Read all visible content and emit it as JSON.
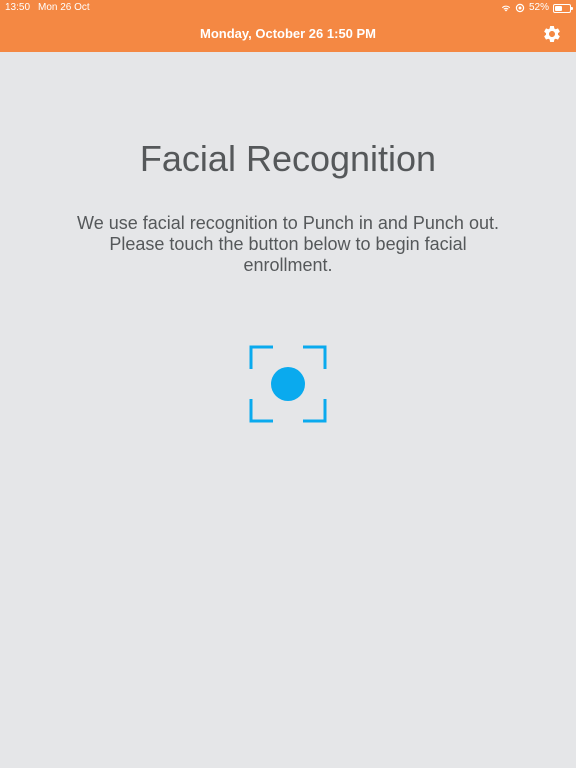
{
  "status_bar": {
    "time": "13:50",
    "date": "Mon 26 Oct",
    "battery_percent": "52%",
    "battery_level": 0.52,
    "icons": [
      "wifi-icon",
      "location-icon",
      "battery-icon"
    ]
  },
  "header": {
    "title": "Monday, October 26  1:50 PM",
    "settings_icon": "gear-icon",
    "background_color": "#f48843"
  },
  "main": {
    "title": "Facial Recognition",
    "description": "We use facial recognition to Punch in and Punch out. Please touch the button below to begin facial enrollment.",
    "enroll_icon": "face-scan-icon",
    "accent_color": "#0aaaee"
  }
}
